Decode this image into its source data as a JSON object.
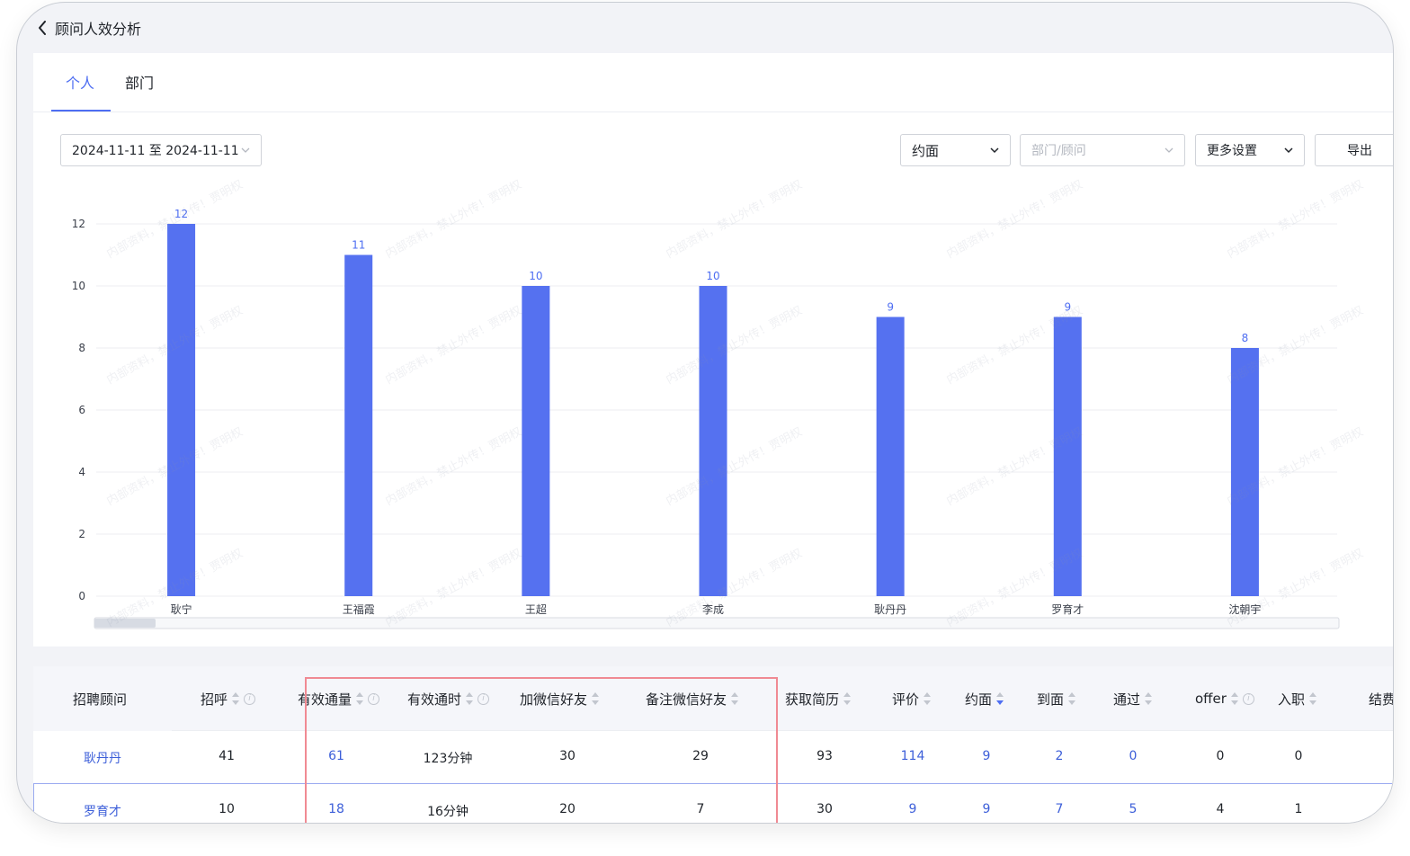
{
  "topbar": {
    "title": "顾问人效分析"
  },
  "tabs": [
    {
      "label": "个人"
    },
    {
      "label": "部门"
    }
  ],
  "filters": {
    "date_range": "2024-11-11 至 2024-11-11",
    "metric_select": "约面",
    "dept_placeholder": "部门/顾问",
    "more_settings": "更多设置",
    "export": "导出"
  },
  "watermark": "内部资料，禁止外传！贾明权",
  "chart_data": {
    "type": "bar",
    "categories": [
      "耿宁",
      "王福霞",
      "王超",
      "李成",
      "耿丹丹",
      "罗育才",
      "沈朝宇"
    ],
    "values": [
      12,
      11,
      10,
      10,
      9,
      9,
      8
    ],
    "ylim": [
      0,
      12
    ],
    "yticks": [
      0,
      2,
      4,
      6,
      8,
      10,
      12
    ],
    "grid": true,
    "bar_color": "#5571f0",
    "label_color": "#4e6ef2"
  },
  "table": {
    "headers": [
      {
        "label": "招聘顾问",
        "sort": false,
        "info": false
      },
      {
        "label": "招呼",
        "sort": true,
        "info": true
      },
      {
        "label": "有效通量",
        "sort": true,
        "info": true
      },
      {
        "label": "有效通时",
        "sort": true,
        "info": true
      },
      {
        "label": "加微信好友",
        "sort": true,
        "info": false
      },
      {
        "label": "备注微信好友",
        "sort": true,
        "info": false
      },
      {
        "label": "获取简历",
        "sort": true,
        "info": false
      },
      {
        "label": "评价",
        "sort": true,
        "info": false
      },
      {
        "label": "约面",
        "sort": true,
        "info": false,
        "active": true
      },
      {
        "label": "到面",
        "sort": true,
        "info": false
      },
      {
        "label": "通过",
        "sort": true,
        "info": false
      },
      {
        "label": "offer",
        "sort": true,
        "info": true
      },
      {
        "label": "入职",
        "sort": true,
        "info": false
      },
      {
        "label": "结费",
        "sort": false,
        "info": false
      }
    ],
    "rows": [
      [
        "耿丹丹",
        "41",
        "61",
        "123分钟",
        "30",
        "29",
        "93",
        "114",
        "9",
        "2",
        "0",
        "0",
        "0"
      ],
      [
        "罗育才",
        "10",
        "18",
        "16分钟",
        "20",
        "7",
        "30",
        "9",
        "9",
        "7",
        "5",
        "4",
        "1"
      ]
    ]
  },
  "colors": {
    "accent": "#4e6ef2",
    "highlight_box": "#f08a93"
  }
}
